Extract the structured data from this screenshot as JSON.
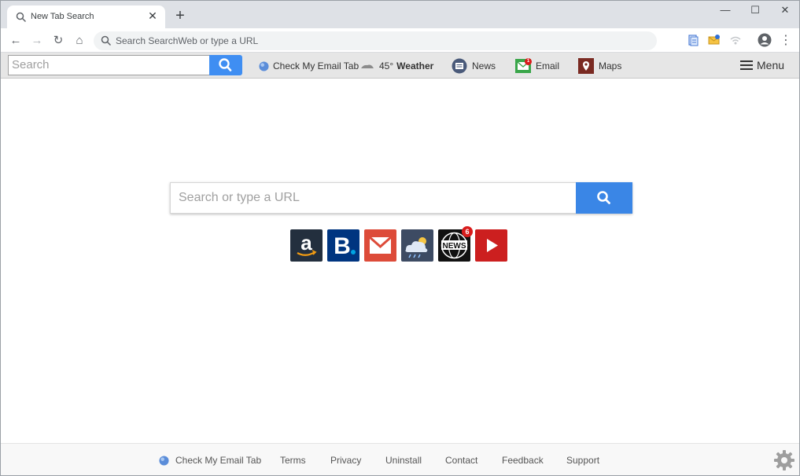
{
  "browser": {
    "tab_title": "New Tab Search",
    "tab_close": "✕",
    "new_tab": "+",
    "window_controls": {
      "minimize": "—",
      "maximize": "☐",
      "close": "✕"
    },
    "address_placeholder": "Search SearchWeb or type a URL",
    "nav": {
      "back": "←",
      "forward": "→",
      "reload": "↻",
      "home": "⌂",
      "more": "⋮"
    }
  },
  "extension_bar": {
    "search_placeholder": "Search",
    "check_email": "Check My Email Tab",
    "weather_temp": "45°",
    "weather_label": "Weather",
    "news": "News",
    "email": "Email",
    "maps": "Maps",
    "menu": "Menu",
    "email_badge": "1"
  },
  "main": {
    "search_placeholder": "Search or type a URL",
    "tiles": [
      {
        "name": "amazon",
        "letter": "a",
        "bg": "#232f3e"
      },
      {
        "name": "booking",
        "letter": "B",
        "bg": "#003580"
      },
      {
        "name": "gmail",
        "letter": "",
        "bg": "#dd4b39"
      },
      {
        "name": "weather",
        "letter": "",
        "bg": "#3d4b63"
      },
      {
        "name": "news",
        "letter": "NEWS",
        "bg": "#111111",
        "badge": "6"
      },
      {
        "name": "youtube",
        "letter": "",
        "bg": "#cc1f1f"
      }
    ]
  },
  "footer": {
    "check_email": "Check My Email Tab",
    "terms": "Terms",
    "privacy": "Privacy",
    "uninstall": "Uninstall",
    "contact": "Contact",
    "feedback": "Feedback",
    "support": "Support"
  },
  "colors": {
    "accent": "#3a86e6",
    "tabstrip": "#dee1e6",
    "extbar": "#e6e6e6"
  }
}
